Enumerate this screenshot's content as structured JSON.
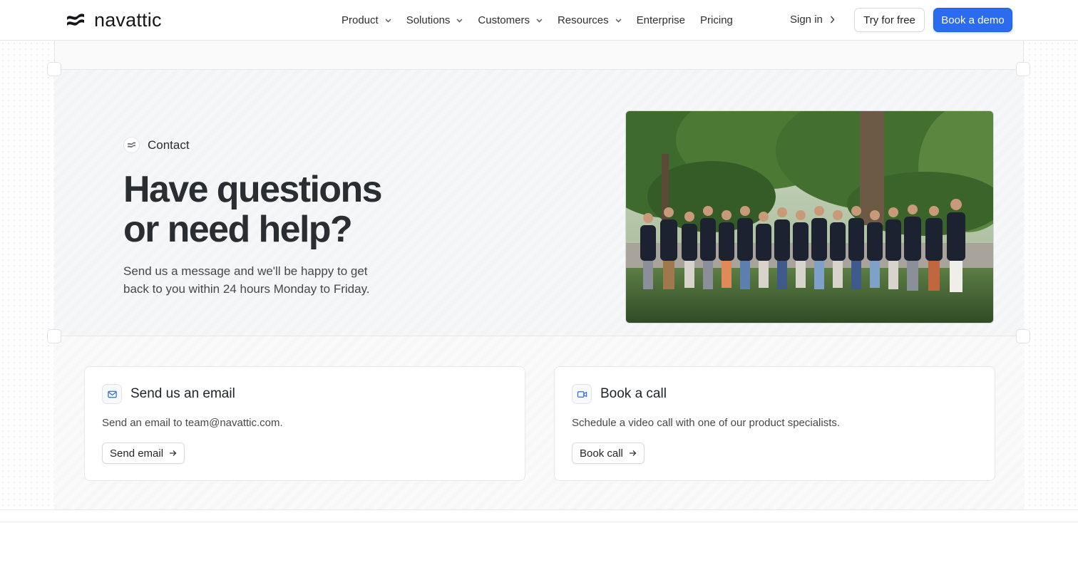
{
  "brand": {
    "name": "navattic",
    "accent": "#2b6bf0"
  },
  "nav": {
    "items": [
      {
        "label": "Product",
        "has_dropdown": true
      },
      {
        "label": "Solutions",
        "has_dropdown": true
      },
      {
        "label": "Customers",
        "has_dropdown": true
      },
      {
        "label": "Resources",
        "has_dropdown": true
      },
      {
        "label": "Enterprise",
        "has_dropdown": false
      },
      {
        "label": "Pricing",
        "has_dropdown": false
      }
    ],
    "sign_in": "Sign in",
    "try_free": "Try for free",
    "book_demo": "Book a demo"
  },
  "hero": {
    "eyebrow": "Contact",
    "headline_line1": "Have questions",
    "headline_line2": "or need help?",
    "subtext": "Send us a message and we'll be happy to get back to you within 24 hours Monday to Friday.",
    "photo_icon": "team-group-photo"
  },
  "cards": {
    "email": {
      "icon": "mail-icon",
      "title": "Send us an email",
      "description": "Send an email to team@navattic.com.",
      "button": "Send email"
    },
    "call": {
      "icon": "video-icon",
      "title": "Book a call",
      "description": "Schedule a video call with one of our product specialists.",
      "button": "Book call"
    }
  }
}
